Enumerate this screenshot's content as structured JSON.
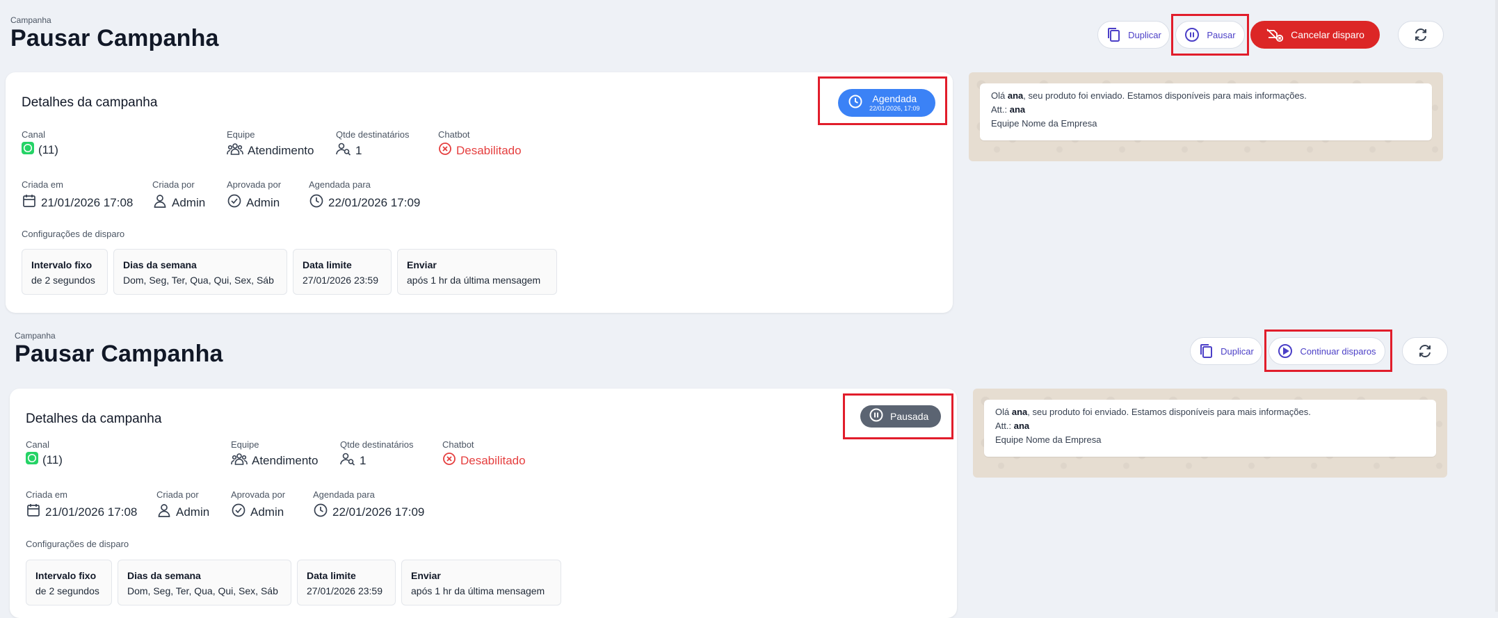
{
  "panels": [
    {
      "breadcrumb": "Campanha",
      "title": "Pausar Campanha",
      "actions": {
        "duplicate": "Duplicar",
        "pause": "Pausar",
        "cancel": "Cancelar disparo"
      },
      "card": {
        "title": "Detalhes da campanha",
        "status_label": "Agendada",
        "status_date": "22/01/2026, 17:09",
        "canal_label": "Canal",
        "canal_value": "(11)",
        "equipe_label": "Equipe",
        "equipe_value": "Atendimento",
        "qtde_label": "Qtde destinatários",
        "qtde_value": "1",
        "chatbot_label": "Chatbot",
        "chatbot_value": "Desabilitado",
        "criada_em_label": "Criada em",
        "criada_em_value": "21/01/2026 17:08",
        "criada_por_label": "Criada por",
        "criada_por_value": "Admin",
        "aprovada_por_label": "Aprovada por",
        "aprovada_por_value": "Admin",
        "agendada_para_label": "Agendada para",
        "agendada_para_value": "22/01/2026 17:09",
        "config_label": "Configurações de disparo",
        "configs": [
          {
            "title": "Intervalo fixo",
            "value": "de 2 segundos"
          },
          {
            "title": "Dias da semana",
            "value": "Dom, Seg, Ter, Qua, Qui, Sex, Sáb"
          },
          {
            "title": "Data limite",
            "value": "27/01/2026 23:59"
          },
          {
            "title": "Enviar",
            "value": "após 1 hr da última mensagem"
          }
        ]
      },
      "message": {
        "greeting": "Olá",
        "name": "ana",
        "text": ", seu produto foi enviado. Estamos disponíveis para mais informações.",
        "att": "Att.:",
        "att_name": "ana",
        "team": "Equipe Nome da Empresa"
      }
    },
    {
      "breadcrumb": "Campanha",
      "title": "Pausar Campanha",
      "actions": {
        "duplicate": "Duplicar",
        "continue": "Continuar disparos"
      },
      "card": {
        "title": "Detalhes da campanha",
        "status_label": "Pausada",
        "canal_label": "Canal",
        "canal_value": "(11)",
        "equipe_label": "Equipe",
        "equipe_value": "Atendimento",
        "qtde_label": "Qtde destinatários",
        "qtde_value": "1",
        "chatbot_label": "Chatbot",
        "chatbot_value": "Desabilitado",
        "criada_em_label": "Criada em",
        "criada_em_value": "21/01/2026 17:08",
        "criada_por_label": "Criada por",
        "criada_por_value": "Admin",
        "aprovada_por_label": "Aprovada por",
        "aprovada_por_value": "Admin",
        "agendada_para_label": "Agendada para",
        "agendada_para_value": "22/01/2026 17:09",
        "config_label": "Configurações de disparo",
        "configs": [
          {
            "title": "Intervalo fixo",
            "value": "de 2 segundos"
          },
          {
            "title": "Dias da semana",
            "value": "Dom, Seg, Ter, Qua, Qui, Sex, Sáb"
          },
          {
            "title": "Data limite",
            "value": "27/01/2026 23:59"
          },
          {
            "title": "Enviar",
            "value": "após 1 hr da última mensagem"
          }
        ]
      },
      "message": {
        "greeting": "Olá",
        "name": "ana",
        "text": ", seu produto foi enviado. Estamos disponíveis para mais informações.",
        "att": "Att.:",
        "att_name": "ana",
        "team": "Equipe Nome da Empresa"
      }
    }
  ],
  "colors": {
    "accent": "#4b3fc7",
    "danger": "#dc2626",
    "status_scheduled": "#3b82f6",
    "status_paused": "#5b6472",
    "whatsapp": "#25d366",
    "highlight": "#e11d2b"
  },
  "icons": {
    "duplicate": "copy-icon",
    "pause": "pause-circle-icon",
    "cancel": "send-off-icon",
    "refresh": "refresh-icon",
    "continue": "play-circle-icon",
    "canal": "whatsapp-icon",
    "equipe": "users-icon",
    "qtde": "user-search-icon",
    "chatbot": "x-circle-icon",
    "criada_em": "calendar-icon",
    "criada_por": "user-icon",
    "aprovada_por": "check-circle-icon",
    "agendada_para": "clock-icon"
  }
}
